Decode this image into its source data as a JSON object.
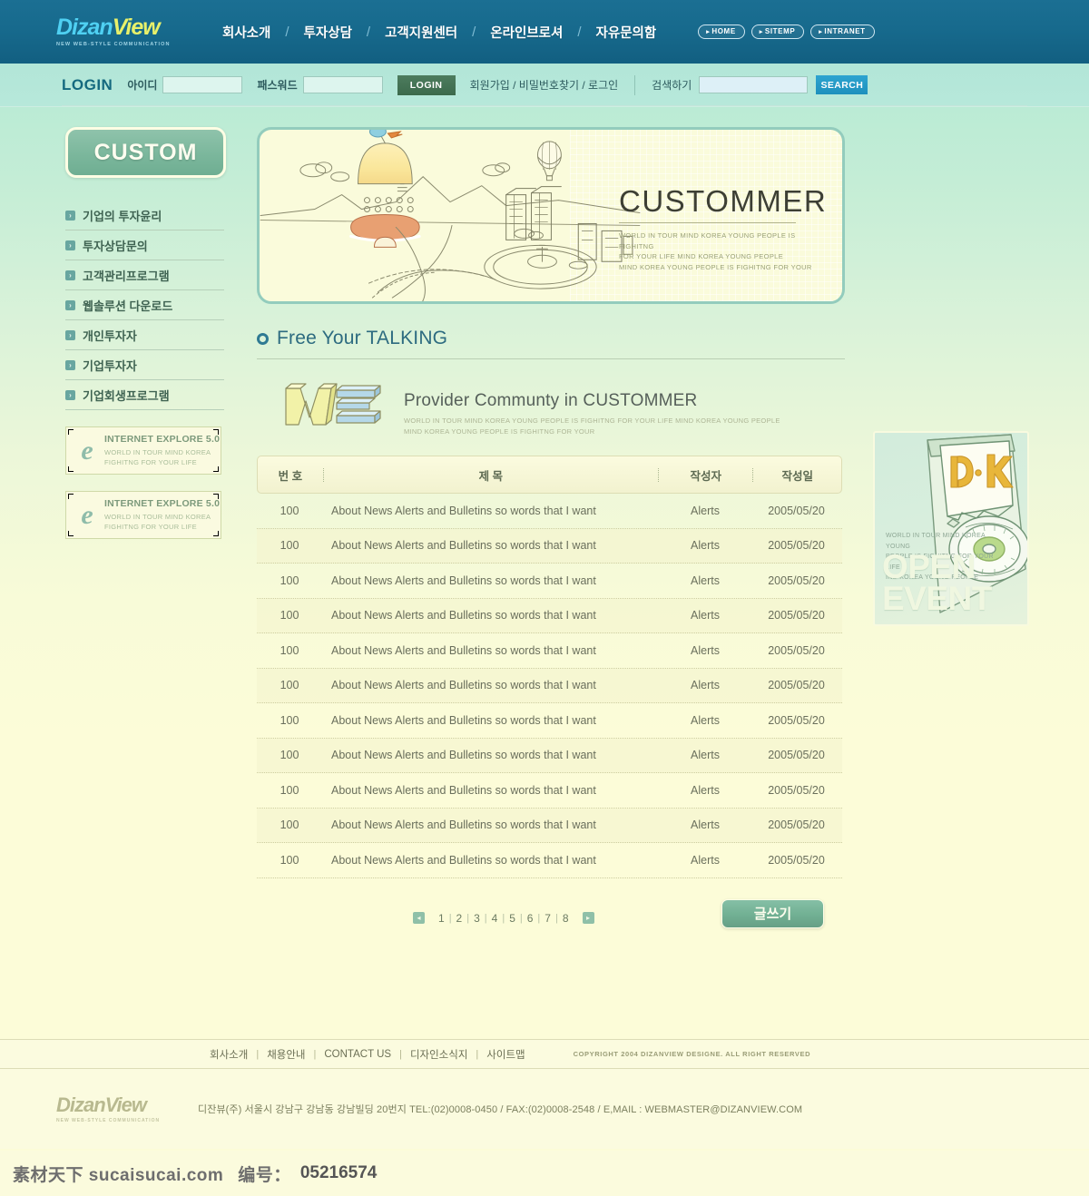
{
  "brand": {
    "name_part1": "Dizan",
    "name_part2": "View",
    "tagline": "NEW WEB-STYLE COMMUNICATION"
  },
  "topnav": {
    "items": [
      {
        "label": "회사소개"
      },
      {
        "label": "투자상담"
      },
      {
        "label": "고객지원센터"
      },
      {
        "label": "온라인브로셔"
      },
      {
        "label": "자유문의함"
      }
    ],
    "separator": "/",
    "pills": [
      {
        "label": "HOME"
      },
      {
        "label": "SITEMP"
      },
      {
        "label": "INTRANET"
      }
    ],
    "pill_dot": "▸"
  },
  "login": {
    "title": "LOGIN",
    "id_label": "아이디",
    "id_value": "",
    "id_placeholder": "",
    "pw_label": "패스워드",
    "pw_value": "",
    "pw_placeholder": "",
    "button": "LOGIN",
    "links": "회원가입 / 비밀번호찾기 / 로그인",
    "search_label": "검색하기",
    "search_value": "",
    "search_placeholder": "",
    "search_button": "SEARCH"
  },
  "sidebar": {
    "header": "CUSTOM",
    "items": [
      {
        "label": "기업의 투자윤리"
      },
      {
        "label": "투자상담문의"
      },
      {
        "label": "고객관리프로그램"
      },
      {
        "label": "웹솔루션 다운로드"
      },
      {
        "label": "개인투자자"
      },
      {
        "label": "기업투자자"
      },
      {
        "label": "기업회생프로그램"
      }
    ],
    "arrow_glyph": "›",
    "banners": [
      {
        "title": "INTERNET EXPLORE 5.0",
        "line1": "WORLD IN TOUR MIND KOREA",
        "line2": "FIGHITNG FOR YOUR LIFE",
        "logo": "e"
      },
      {
        "title": "INTERNET EXPLORE 5.0",
        "line1": "WORLD IN TOUR MIND KOREA",
        "line2": "FIGHITNG FOR YOUR LIFE",
        "logo": "e"
      }
    ]
  },
  "hero": {
    "title": "CUSTOMMER",
    "sub_line1": "WORLD IN TOUR MIND KOREA YOUNG PEOPLE IS FIGHITNG",
    "sub_line2": "FOR YOUR LIFE MIND KOREA YOUNG PEOPLE",
    "sub_line3": "MIND KOREA YOUNG PEOPLE IS FIGHITNG FOR YOUR"
  },
  "section": {
    "title": "Free Your TALKING"
  },
  "board": {
    "logo_text": "WE",
    "heading": "Provider Communty in CUSTOMMER",
    "desc_line1": "WORLD IN TOUR MIND KOREA YOUNG PEOPLE IS FIGHITNG  FOR YOUR LIFE MIND KOREA YOUNG PEOPLE",
    "desc_line2": "MIND KOREA YOUNG PEOPLE IS FIGHITNG FOR YOUR",
    "columns": {
      "no": "번 호",
      "title": "제  목",
      "author": "작성자",
      "date": "작성일"
    },
    "rows": [
      {
        "no": "100",
        "title": "About News Alerts and Bulletins so words that I want",
        "author": "Alerts",
        "date": "2005/05/20"
      },
      {
        "no": "100",
        "title": "About News Alerts and Bulletins so words that I want",
        "author": "Alerts",
        "date": "2005/05/20"
      },
      {
        "no": "100",
        "title": "About News Alerts and Bulletins so words that I want",
        "author": "Alerts",
        "date": "2005/05/20"
      },
      {
        "no": "100",
        "title": "About News Alerts and Bulletins so words that I want",
        "author": "Alerts",
        "date": "2005/05/20"
      },
      {
        "no": "100",
        "title": "About News Alerts and Bulletins so words that I want",
        "author": "Alerts",
        "date": "2005/05/20"
      },
      {
        "no": "100",
        "title": "About News Alerts and Bulletins so words that I want",
        "author": "Alerts",
        "date": "2005/05/20"
      },
      {
        "no": "100",
        "title": "About News Alerts and Bulletins so words that I want",
        "author": "Alerts",
        "date": "2005/05/20"
      },
      {
        "no": "100",
        "title": "About News Alerts and Bulletins so words that I want",
        "author": "Alerts",
        "date": "2005/05/20"
      },
      {
        "no": "100",
        "title": "About News Alerts and Bulletins so words that I want",
        "author": "Alerts",
        "date": "2005/05/20"
      },
      {
        "no": "100",
        "title": "About News Alerts and Bulletins so words that I want",
        "author": "Alerts",
        "date": "2005/05/20"
      },
      {
        "no": "100",
        "title": "About News Alerts and Bulletins so words that I want",
        "author": "Alerts",
        "date": "2005/05/20"
      }
    ]
  },
  "pager": {
    "prev_glyph": "◂",
    "next_glyph": "▸",
    "pages": [
      "1",
      "2",
      "3",
      "4",
      "5",
      "6",
      "7",
      "8"
    ],
    "separator": "|",
    "write_button": "글쓰기"
  },
  "promo": {
    "badge": "D·K",
    "desc_line1": "WORLD IN TOUR MIND KOREA YOUNG",
    "desc_line2": "PEOPLE IS FIGHITNG FOR YOUR LIFE",
    "desc_line3": "IND KOREA YOUNG PEOPLE",
    "big_line1": "OPEN",
    "big_line2": "EVENT"
  },
  "footer": {
    "links": [
      {
        "label": "회사소개"
      },
      {
        "label": "채용안내"
      },
      {
        "label": "CONTACT US"
      },
      {
        "label": "디자인소식지"
      },
      {
        "label": "사이트맵"
      }
    ],
    "separator": "|",
    "copyright": "COPYRIGHT 2004 DIZANVIEW DESIGNE. ALL RIGHT RESERVED",
    "address": "디잔뷰(주) 서울시 강남구 강남동 강남빌딩 20번지  TEL:(02)0008-0450 / FAX:(02)0008-2548 / E,MAIL : WEBMASTER@DIZANVIEW.COM"
  },
  "watermark": {
    "site": "素材天下 sucaisucai.com",
    "id_label": "编号：",
    "id_value": "05216574"
  },
  "colors": {
    "nav_blue": "#176a8d",
    "login_mint": "#b2e6d8",
    "accent_teal": "#2d6b80",
    "cream": "#fcfcd8",
    "green_button": "#71b093"
  }
}
